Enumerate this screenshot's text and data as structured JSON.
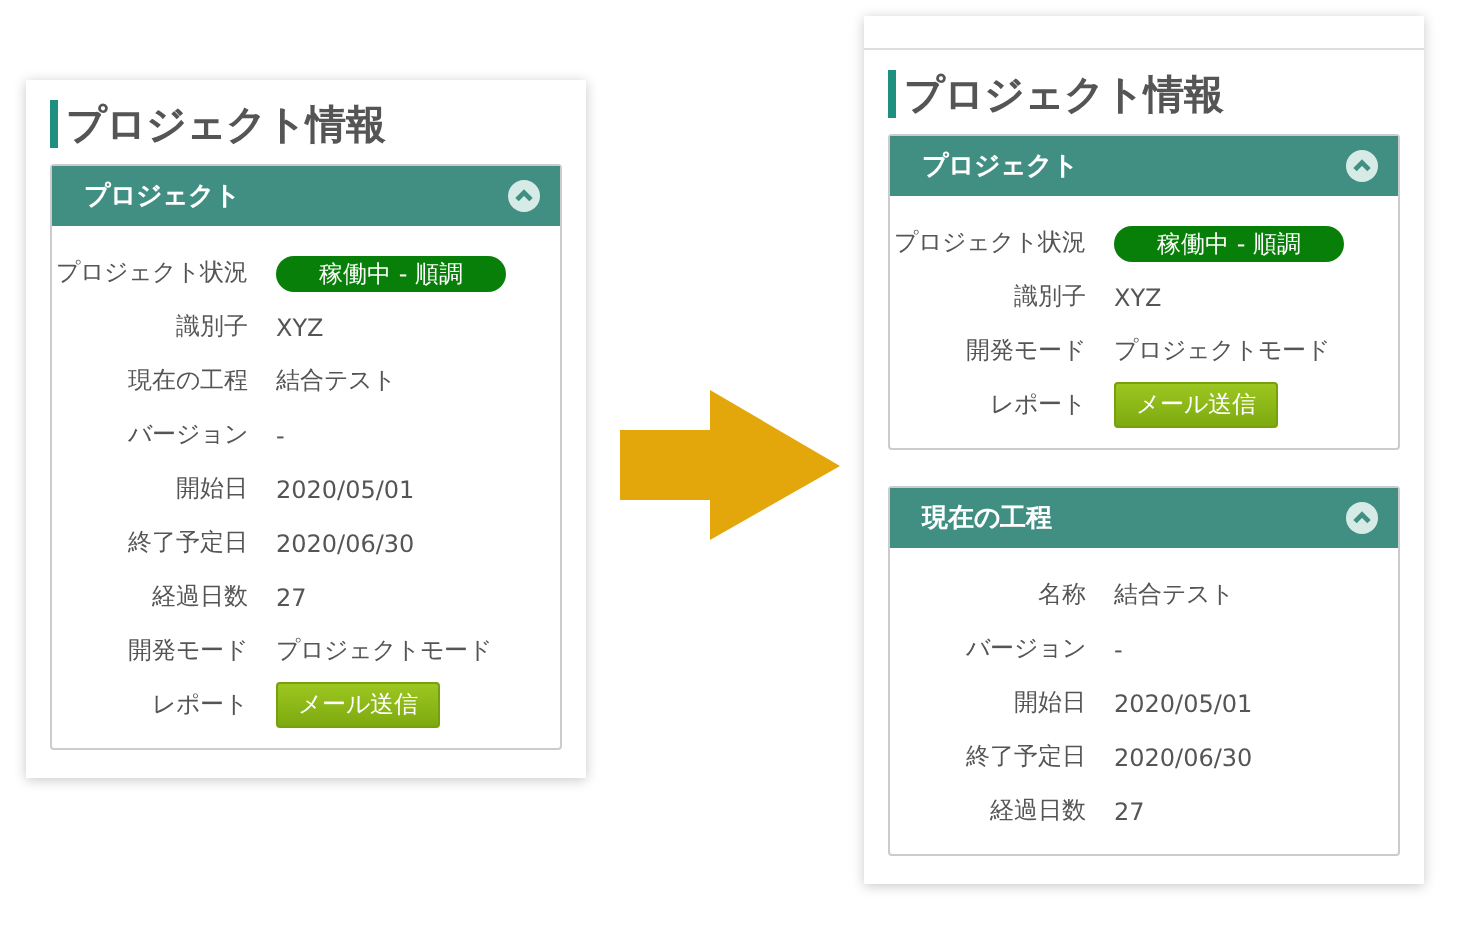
{
  "before": {
    "title": "プロジェクト情報",
    "sections": [
      {
        "heading": "プロジェクト",
        "expanded": true,
        "rows": [
          {
            "label": "プロジェクト状況",
            "kind": "status",
            "value": "稼働中 - 順調"
          },
          {
            "label": "識別子",
            "kind": "text",
            "value": "XYZ"
          },
          {
            "label": "現在の工程",
            "kind": "text",
            "value": "結合テスト"
          },
          {
            "label": "バージョン",
            "kind": "text",
            "value": "-"
          },
          {
            "label": "開始日",
            "kind": "text",
            "value": "2020/05/01"
          },
          {
            "label": "終了予定日",
            "kind": "text",
            "value": "2020/06/30"
          },
          {
            "label": "経過日数",
            "kind": "text",
            "value": "27"
          },
          {
            "label": "開発モード",
            "kind": "text",
            "value": "プロジェクトモード"
          },
          {
            "label": "レポート",
            "kind": "button",
            "value": "メール送信"
          }
        ]
      }
    ]
  },
  "after": {
    "title": "プロジェクト情報",
    "sections": [
      {
        "heading": "プロジェクト",
        "expanded": true,
        "rows": [
          {
            "label": "プロジェクト状況",
            "kind": "status",
            "value": "稼働中 - 順調"
          },
          {
            "label": "識別子",
            "kind": "text",
            "value": "XYZ"
          },
          {
            "label": "開発モード",
            "kind": "text",
            "value": "プロジェクトモード"
          },
          {
            "label": "レポート",
            "kind": "button",
            "value": "メール送信"
          }
        ]
      },
      {
        "heading": "現在の工程",
        "expanded": true,
        "rows": [
          {
            "label": "名称",
            "kind": "text",
            "value": "結合テスト"
          },
          {
            "label": "バージョン",
            "kind": "text",
            "value": "-"
          },
          {
            "label": "開始日",
            "kind": "text",
            "value": "2020/05/01"
          },
          {
            "label": "終了予定日",
            "kind": "text",
            "value": "2020/06/30"
          },
          {
            "label": "経過日数",
            "kind": "text",
            "value": "27"
          }
        ]
      }
    ]
  }
}
